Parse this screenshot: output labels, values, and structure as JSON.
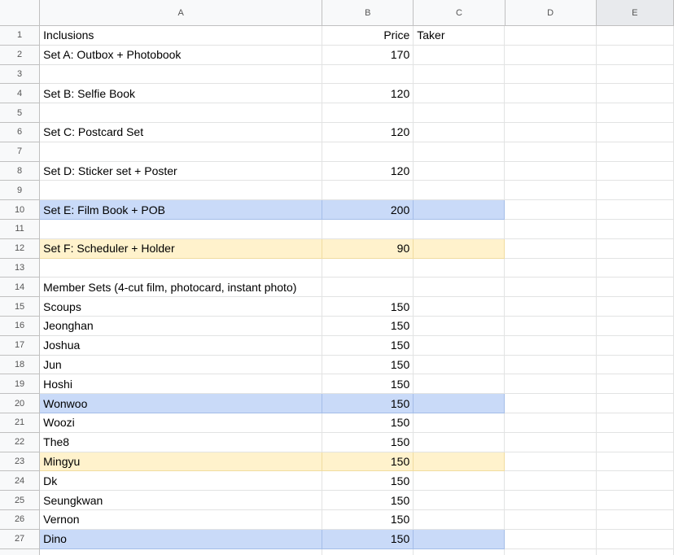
{
  "columns": [
    "A",
    "B",
    "C",
    "D",
    "E"
  ],
  "colors": {
    "blue_highlight": "#c9daf8",
    "yellow_highlight": "#fff2cc",
    "header_bg": "#f8f9fa"
  },
  "rows": [
    {
      "n": "1",
      "a": "Inclusions",
      "b": "Price",
      "c": "Taker",
      "hl": ""
    },
    {
      "n": "2",
      "a": "Set A: Outbox + Photobook",
      "b": "170",
      "c": "",
      "hl": ""
    },
    {
      "n": "3",
      "a": "",
      "b": "",
      "c": "",
      "hl": ""
    },
    {
      "n": "4",
      "a": "Set B: Selfie Book",
      "b": "120",
      "c": "",
      "hl": ""
    },
    {
      "n": "5",
      "a": "",
      "b": "",
      "c": "",
      "hl": ""
    },
    {
      "n": "6",
      "a": "Set C: Postcard Set",
      "b": "120",
      "c": "",
      "hl": ""
    },
    {
      "n": "7",
      "a": "",
      "b": "",
      "c": "",
      "hl": ""
    },
    {
      "n": "8",
      "a": "Set D: Sticker set + Poster",
      "b": "120",
      "c": "",
      "hl": ""
    },
    {
      "n": "9",
      "a": "",
      "b": "",
      "c": "",
      "hl": ""
    },
    {
      "n": "10",
      "a": "Set E: Film Book + POB",
      "b": "200",
      "c": "",
      "hl": "blue"
    },
    {
      "n": "11",
      "a": "",
      "b": "",
      "c": "",
      "hl": ""
    },
    {
      "n": "12",
      "a": "Set F: Scheduler + Holder",
      "b": "90",
      "c": "",
      "hl": "yellow"
    },
    {
      "n": "13",
      "a": "",
      "b": "",
      "c": "",
      "hl": ""
    },
    {
      "n": "14",
      "a": "Member Sets (4-cut film, photocard, instant photo)",
      "b": "",
      "c": "",
      "hl": ""
    },
    {
      "n": "15",
      "a": "Scoups",
      "b": "150",
      "c": "",
      "hl": ""
    },
    {
      "n": "16",
      "a": "Jeonghan",
      "b": "150",
      "c": "",
      "hl": ""
    },
    {
      "n": "17",
      "a": "Joshua",
      "b": "150",
      "c": "",
      "hl": ""
    },
    {
      "n": "18",
      "a": "Jun",
      "b": "150",
      "c": "",
      "hl": ""
    },
    {
      "n": "19",
      "a": "Hoshi",
      "b": "150",
      "c": "",
      "hl": ""
    },
    {
      "n": "20",
      "a": "Wonwoo",
      "b": "150",
      "c": "",
      "hl": "blue"
    },
    {
      "n": "21",
      "a": "Woozi",
      "b": "150",
      "c": "",
      "hl": ""
    },
    {
      "n": "22",
      "a": "The8",
      "b": "150",
      "c": "",
      "hl": ""
    },
    {
      "n": "23",
      "a": "Mingyu",
      "b": "150",
      "c": "",
      "hl": "yellow"
    },
    {
      "n": "24",
      "a": "Dk",
      "b": "150",
      "c": "",
      "hl": ""
    },
    {
      "n": "25",
      "a": "Seungkwan",
      "b": "150",
      "c": "",
      "hl": ""
    },
    {
      "n": "26",
      "a": "Vernon",
      "b": "150",
      "c": "",
      "hl": ""
    },
    {
      "n": "27",
      "a": "Dino",
      "b": "150",
      "c": "",
      "hl": "blue"
    }
  ]
}
